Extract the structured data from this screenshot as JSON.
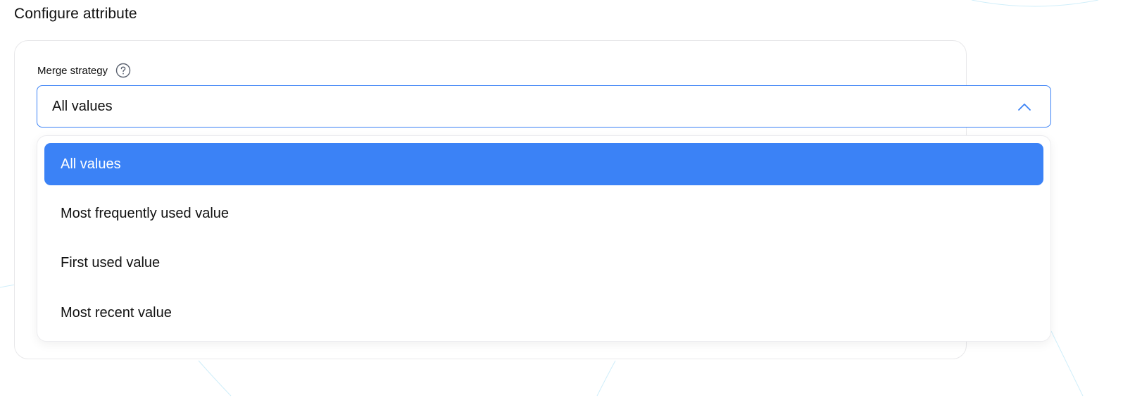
{
  "page": {
    "title": "Configure attribute"
  },
  "field": {
    "label": "Merge strategy",
    "help_icon": "question-circle-icon"
  },
  "select": {
    "value": "All values",
    "expanded": true,
    "chevron_icon": "chevron-up-icon"
  },
  "options": [
    {
      "label": "All values",
      "selected": true
    },
    {
      "label": "Most frequently used value",
      "selected": false
    },
    {
      "label": "First used value",
      "selected": false
    },
    {
      "label": "Most recent value",
      "selected": false
    }
  ],
  "colors": {
    "accent": "#3b82f6",
    "text": "#111111",
    "border": "#e8e8ea",
    "background_arcs": "#cfeefa"
  }
}
